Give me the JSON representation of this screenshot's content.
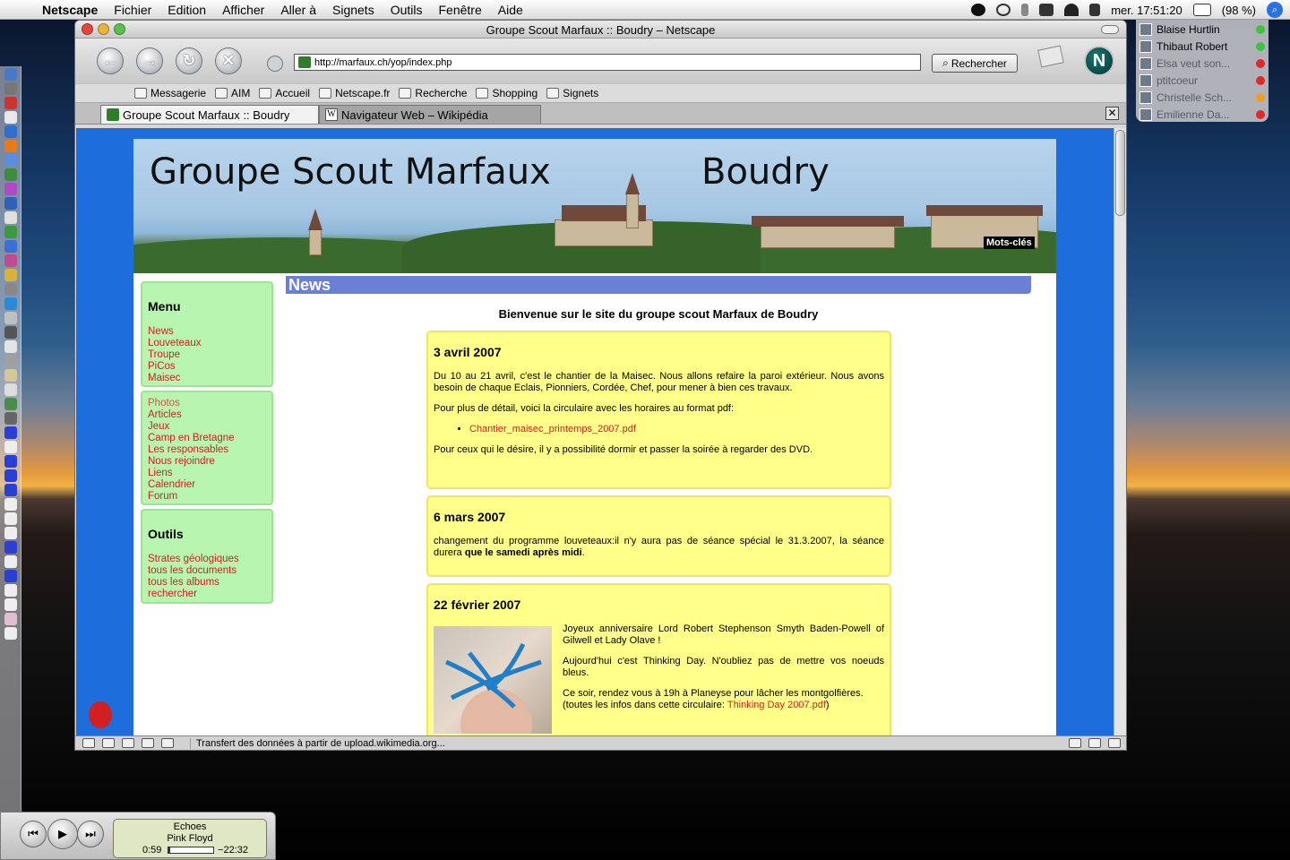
{
  "menubar": {
    "app": "Netscape",
    "items": [
      "Fichier",
      "Edition",
      "Afficher",
      "Aller à",
      "Signets",
      "Outils",
      "Fenêtre",
      "Aide"
    ],
    "battery": "(98 %)",
    "clock": "mer. 17:51:20"
  },
  "buddies": [
    {
      "name": "Blaise Hurtlin",
      "status": "#3cc43c",
      "idle": false
    },
    {
      "name": "Thibaut Robert",
      "status": "#3cc43c",
      "idle": false
    },
    {
      "name": "Elsa veut son...",
      "status": "#e02a2a",
      "idle": true
    },
    {
      "name": "ptitcoeur",
      "status": "#e02a2a",
      "idle": true
    },
    {
      "name": "Christelle Sch...",
      "status": "#f0a020",
      "idle": true
    },
    {
      "name": "Emilienne Da...",
      "status": "#e02a2a",
      "idle": true
    }
  ],
  "window": {
    "title": "Groupe Scout Marfaux :: Boudry – Netscape",
    "url": "http://marfaux.ch/yop/index.php",
    "search_label": "Rechercher",
    "status": "Transfert des données à partir de upload.wikimedia.org..."
  },
  "bookmarks": [
    "Messagerie",
    "AIM",
    "Accueil",
    "Netscape.fr",
    "Recherche",
    "Shopping",
    "Signets"
  ],
  "tabs": [
    {
      "label": "Groupe Scout Marfaux :: Boudry",
      "active": true
    },
    {
      "label": "Navigateur Web – Wikipédia",
      "active": false
    }
  ],
  "page": {
    "site_title": "Groupe Scout Marfaux",
    "site_place": "Boudry",
    "mots_cles": "Mots-clés",
    "section": "News",
    "welcome": "Bienvenue sur le site du groupe scout Marfaux de Boudry",
    "menu": {
      "title": "Menu",
      "links": [
        "News",
        "Louveteaux",
        "Troupe",
        "PiCos",
        "Maisec"
      ]
    },
    "links2": [
      "Photos",
      "Articles",
      "Jeux",
      "Camp en Bretagne",
      "Les responsables",
      "Nous rejoindre",
      "Liens",
      "Calendrier",
      "Forum"
    ],
    "outils": {
      "title": "Outils",
      "links": [
        "Strates géologiques",
        "tous les documents",
        "tous les albums",
        "rechercher"
      ]
    },
    "news": [
      {
        "date": "3 avril 2007",
        "p1": "Du 10 au 21 avril, c'est le chantier de la Maisec. Nous allons refaire la paroi extérieur. Nous avons besoin de chaque Eclais, Pionniers, Cordée, Chef, pour mener à bien ces travaux.",
        "p2": "Pour plus de détail, voici la circulaire avec les horaires au format pdf:",
        "link": "Chantier_maisec_printemps_2007.pdf",
        "p3": "Pour ceux qui le désire, il y a possibilité dormir et passer la soirée à regarder des DVD."
      },
      {
        "date": "6 mars 2007",
        "p1a": "changement du programme louveteaux:il n'y aura pas de séance spécial le 31.3.2007, la séance durera ",
        "p1b": "que le samedi après midi",
        "p1c": "."
      },
      {
        "date": "22 février 2007",
        "p1": "Joyeux anniversaire Lord Robert Stephenson Smyth Baden-Powell of Gilwell et Lady Olave !",
        "p2": "Aujourd'hui c'est Thinking Day. N'oubliez pas de mettre vos noeuds bleus.",
        "p3": "Ce soir, rendez vous à 19h à Planeyse pour lâcher les montgolfières.",
        "p4a": "(toutes les infos dans cette circulaire: ",
        "p4link": "Thinking Day 2007.pdf",
        "p4b": ")"
      }
    ]
  },
  "itunes": {
    "song": "Echoes",
    "artist": "Pink Floyd",
    "elapsed": "0:59",
    "remaining": "−22:32",
    "progress": 0.04
  }
}
